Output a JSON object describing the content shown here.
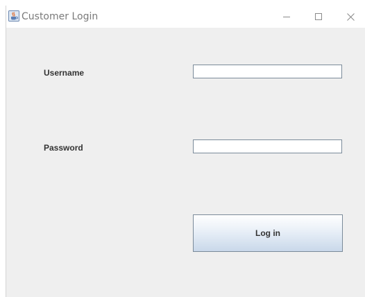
{
  "window": {
    "title": "Customer Login",
    "icon": "java-cup-icon",
    "controls": {
      "minimize": "minimize-icon",
      "maximize": "maximize-icon",
      "close": "close-icon"
    }
  },
  "form": {
    "username_label": "Username",
    "username_value": "",
    "password_label": "Password",
    "password_value": "",
    "login_label": "Log in"
  },
  "colors": {
    "background": "#efefef",
    "titlebar": "#ffffff",
    "label_text": "#333333",
    "field_border": "#7a8a99",
    "button_gradient_top": "#ffffff",
    "button_gradient_bottom": "#c9d8ea"
  }
}
